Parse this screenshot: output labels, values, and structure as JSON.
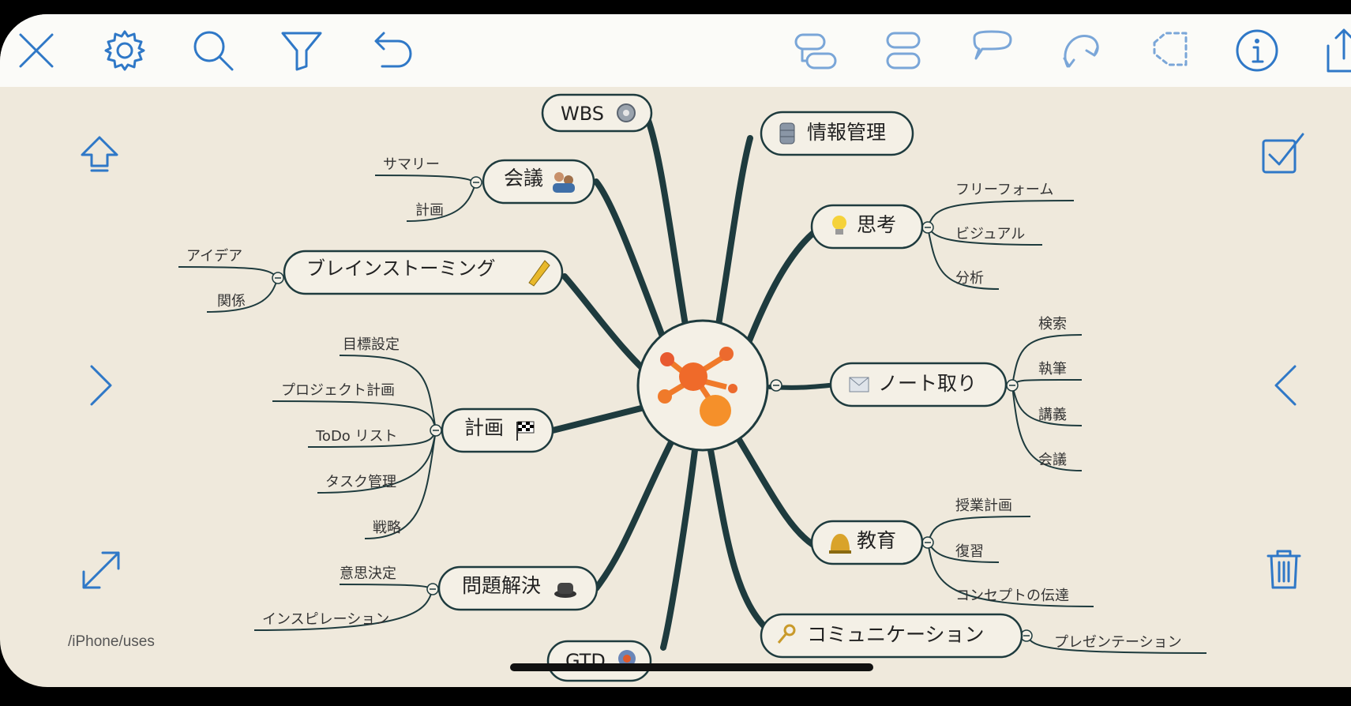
{
  "toolbar": {
    "left": [
      {
        "name": "close-icon"
      },
      {
        "name": "gear-icon"
      },
      {
        "name": "search-icon"
      },
      {
        "name": "filter-icon"
      },
      {
        "name": "undo-icon"
      }
    ],
    "right": [
      {
        "name": "add-child-topic-icon"
      },
      {
        "name": "add-sibling-topic-icon"
      },
      {
        "name": "callout-icon"
      },
      {
        "name": "relationship-icon"
      },
      {
        "name": "boundary-icon"
      },
      {
        "name": "info-icon"
      },
      {
        "name": "share-icon"
      }
    ]
  },
  "side": {
    "left": [
      "up-arrow-icon",
      "chevron-right-icon",
      "expand-icon"
    ],
    "right": [
      "checkbox-icon",
      "chevron-left-icon",
      "trash-icon"
    ]
  },
  "path_label": "/iPhone/uses",
  "central": {
    "icon": "mindmap-logo-icon"
  },
  "topics": {
    "wbs": {
      "label": "WBS",
      "icon": "gear-icon"
    },
    "meeting": {
      "label": "会議",
      "icon": "people-icon",
      "children": [
        "サマリー",
        "計画"
      ]
    },
    "brainstorm": {
      "label": "ブレインストーミング",
      "icon": "pencil-icon",
      "children": [
        "アイデア",
        "関係"
      ]
    },
    "plan": {
      "label": "計画",
      "icon": "checkered-flag-icon",
      "children": [
        "目標設定",
        "プロジェクト計画",
        "ToDo リスト",
        "タスク管理",
        "戦略"
      ]
    },
    "problem": {
      "label": "問題解決",
      "icon": "hat-icon",
      "children": [
        "意思決定",
        "インスピレーション"
      ]
    },
    "gtd": {
      "label": "GTD",
      "icon": "target-icon"
    },
    "info": {
      "label": "情報管理",
      "icon": "database-icon"
    },
    "thinking": {
      "label": "思考",
      "icon": "lightbulb-icon",
      "children": [
        "フリーフォーム",
        "ビジュアル",
        "分析"
      ]
    },
    "notes": {
      "label": "ノート取り",
      "icon": "envelope-icon",
      "children": [
        "検索",
        "執筆",
        "講義",
        "会議"
      ]
    },
    "education": {
      "label": "教育",
      "icon": "bell-icon",
      "children": [
        "授業計画",
        "復習",
        "コンセプトの伝達"
      ]
    },
    "communication": {
      "label": "コミュニケーション",
      "icon": "key-icon",
      "children": [
        "プレゼンテーション"
      ]
    }
  },
  "colors": {
    "canvas": "#efe9dc",
    "toolbar": "#fbfbf8",
    "icon_blue": "#2f78c7",
    "branch": "#1e3b3e",
    "node_fill": "#f4f0e6",
    "logo_orange": "#f07a2a"
  }
}
